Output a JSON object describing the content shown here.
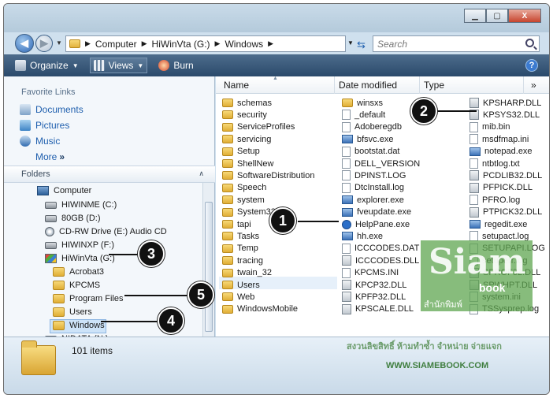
{
  "window": {
    "buttons": {
      "minimize": "▁",
      "maximize": "▢",
      "close": "X"
    }
  },
  "nav": {
    "back_icon": "back-arrow-icon",
    "forward_icon": "forward-arrow-icon",
    "breadcrumbs": [
      "Computer",
      "HiWinVta (G:)",
      "Windows"
    ],
    "search_placeholder": "Search"
  },
  "toolbar": {
    "organize_label": "Organize",
    "views_label": "Views",
    "burn_label": "Burn",
    "help_label": "?"
  },
  "navpane": {
    "favorites_title": "Favorite Links",
    "favorites": [
      "Documents",
      "Pictures",
      "Music"
    ],
    "more_label": "More",
    "more_chevron": "»",
    "folders_title": "Folders",
    "folders_chevron": "∧",
    "tree": [
      {
        "label": "Computer",
        "icon": "computer-icon"
      },
      {
        "label": "HIWINME (C:)",
        "icon": "drive-icon"
      },
      {
        "label": "80GB (D:)",
        "icon": "drive-icon"
      },
      {
        "label": "CD-RW Drive (E:) Audio CD",
        "icon": "cd-drive-icon"
      },
      {
        "label": "HIWINXP (F:)",
        "icon": "drive-icon"
      },
      {
        "label": "HiWinVta (G:)",
        "icon": "drive-icon"
      },
      {
        "label": "Acrobat3",
        "icon": "folder-icon"
      },
      {
        "label": "KPCMS",
        "icon": "folder-icon"
      },
      {
        "label": "Program Files",
        "icon": "folder-icon"
      },
      {
        "label": "Users",
        "icon": "folder-icon"
      },
      {
        "label": "Windows",
        "icon": "folder-icon"
      },
      {
        "label": "NIDATA (N:)",
        "icon": "drive-icon"
      }
    ]
  },
  "columns": {
    "name": "Name",
    "date": "Date modified",
    "type": "Type",
    "more": "»"
  },
  "files": {
    "col1": [
      "schemas",
      "security",
      "ServiceProfiles",
      "servicing",
      "Setup",
      "ShellNew",
      "SoftwareDistribution",
      "Speech",
      "system",
      "System32",
      "tapi",
      "Tasks",
      "Temp",
      "tracing",
      "twain_32",
      "Users",
      "Web",
      "WindowsMobile"
    ],
    "col2": [
      "winsxs",
      "_default",
      "Adoberegdb",
      "bfsvc.exe",
      "bootstat.dat",
      "DELL_VERSION",
      "DPINST.LOG",
      "DtcInstall.log",
      "explorer.exe",
      "fveupdate.exe",
      "HelpPane.exe",
      "hh.exe",
      "ICCCODES.DAT",
      "ICCCODES.DLL",
      "KPCMS.INI",
      "KPCP32.DLL",
      "KPFP32.DLL",
      "KPSCALE.DLL"
    ],
    "col3": [
      "KPSHARP.DLL",
      "KPSYS32.DLL",
      "mib.bin",
      "msdfmap.ini",
      "notepad.exe",
      "ntbtlog.txt",
      "PCDLIB32.DLL",
      "PFPICK.DLL",
      "PFRO.log",
      "PTPICK32.DLL",
      "regedit.exe",
      "setupact.log",
      "SETUPAPI.LOG",
      "setuperr.log",
      "SPROF32.DLL",
      "SPWHPT.DLL",
      "system.ini",
      "TSSysprep.log"
    ]
  },
  "status": {
    "items_count": "101 items"
  },
  "watermark": {
    "logo": "Siam",
    "book": "book",
    "sub": "สำนักพิมพ์",
    "copyright": "สงวนลิขสิทธิ์ ห้ามทำซ้ำ จำหน่าย จ่ายแจก",
    "url": "WWW.SIAMEBOOK.COM"
  },
  "callouts": [
    "1",
    "2",
    "3",
    "4",
    "5"
  ]
}
